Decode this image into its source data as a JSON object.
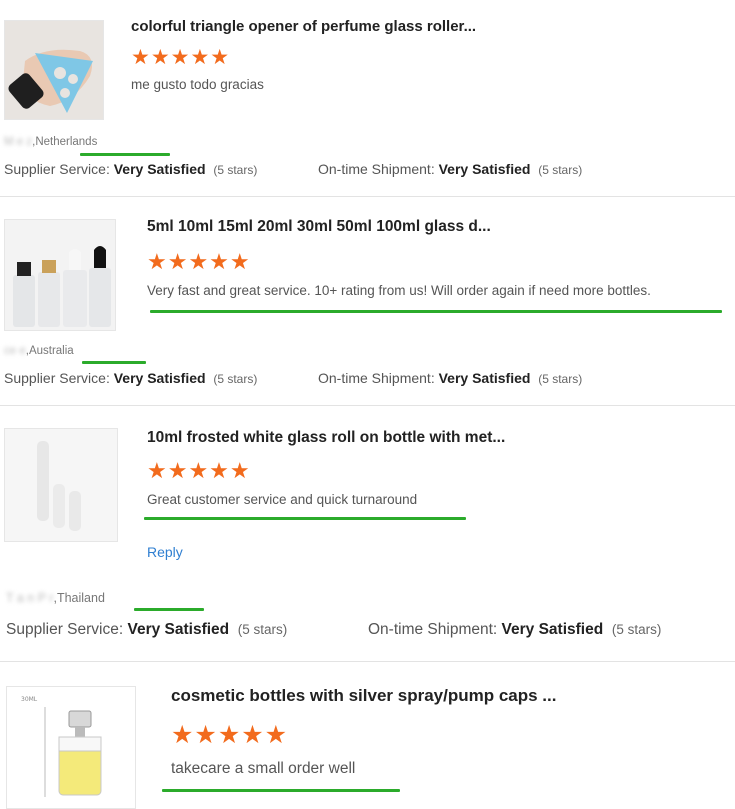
{
  "reviews": [
    {
      "title": "colorful triangle opener of perfume glass roller...",
      "stars": 5,
      "comment": "me gusto todo gracias",
      "reviewer_blurred": "M   e     z",
      "reviewer_country": ",Netherlands",
      "supplier_label": "Supplier Service:",
      "supplier_value": "Very Satisfied",
      "supplier_stars": "(5 stars)",
      "shipment_label": "On-time Shipment:",
      "shipment_value": "Very Satisfied",
      "shipment_stars": "(5 stars)"
    },
    {
      "title": "5ml 10ml 15ml 20ml 30ml 50ml 100ml glass d...",
      "stars": 5,
      "comment": "Very fast and great service. 10+ rating from us! Will order again if need more bottles.",
      "reviewer_blurred": "  ce       e",
      "reviewer_country": ",Australia",
      "supplier_label": "Supplier Service:",
      "supplier_value": "Very Satisfied",
      "supplier_stars": "(5 stars)",
      "shipment_label": "On-time Shipment:",
      "shipment_value": "Very Satisfied",
      "shipment_stars": "(5 stars)"
    },
    {
      "title": "10ml frosted white glass roll on bottle with met...",
      "stars": 5,
      "comment": "Great customer service and quick turnaround",
      "reply": "Reply",
      "reviewer_blurred": "T   a   n P       r",
      "reviewer_country": ",Thailand",
      "supplier_label": "Supplier Service:",
      "supplier_value": "Very Satisfied",
      "supplier_stars": "(5 stars)",
      "shipment_label": "On-time Shipment:",
      "shipment_value": "Very Satisfied",
      "shipment_stars": "(5 stars)"
    },
    {
      "title": "cosmetic bottles with silver spray/pump caps ...",
      "stars": 5,
      "comment": "takecare a small order well"
    }
  ],
  "thumb_label_4": "30ML",
  "star_char": "★★★★★",
  "colors": {
    "star": "#f26b1d",
    "underline": "#2bab2b",
    "link": "#2f7fd1"
  }
}
